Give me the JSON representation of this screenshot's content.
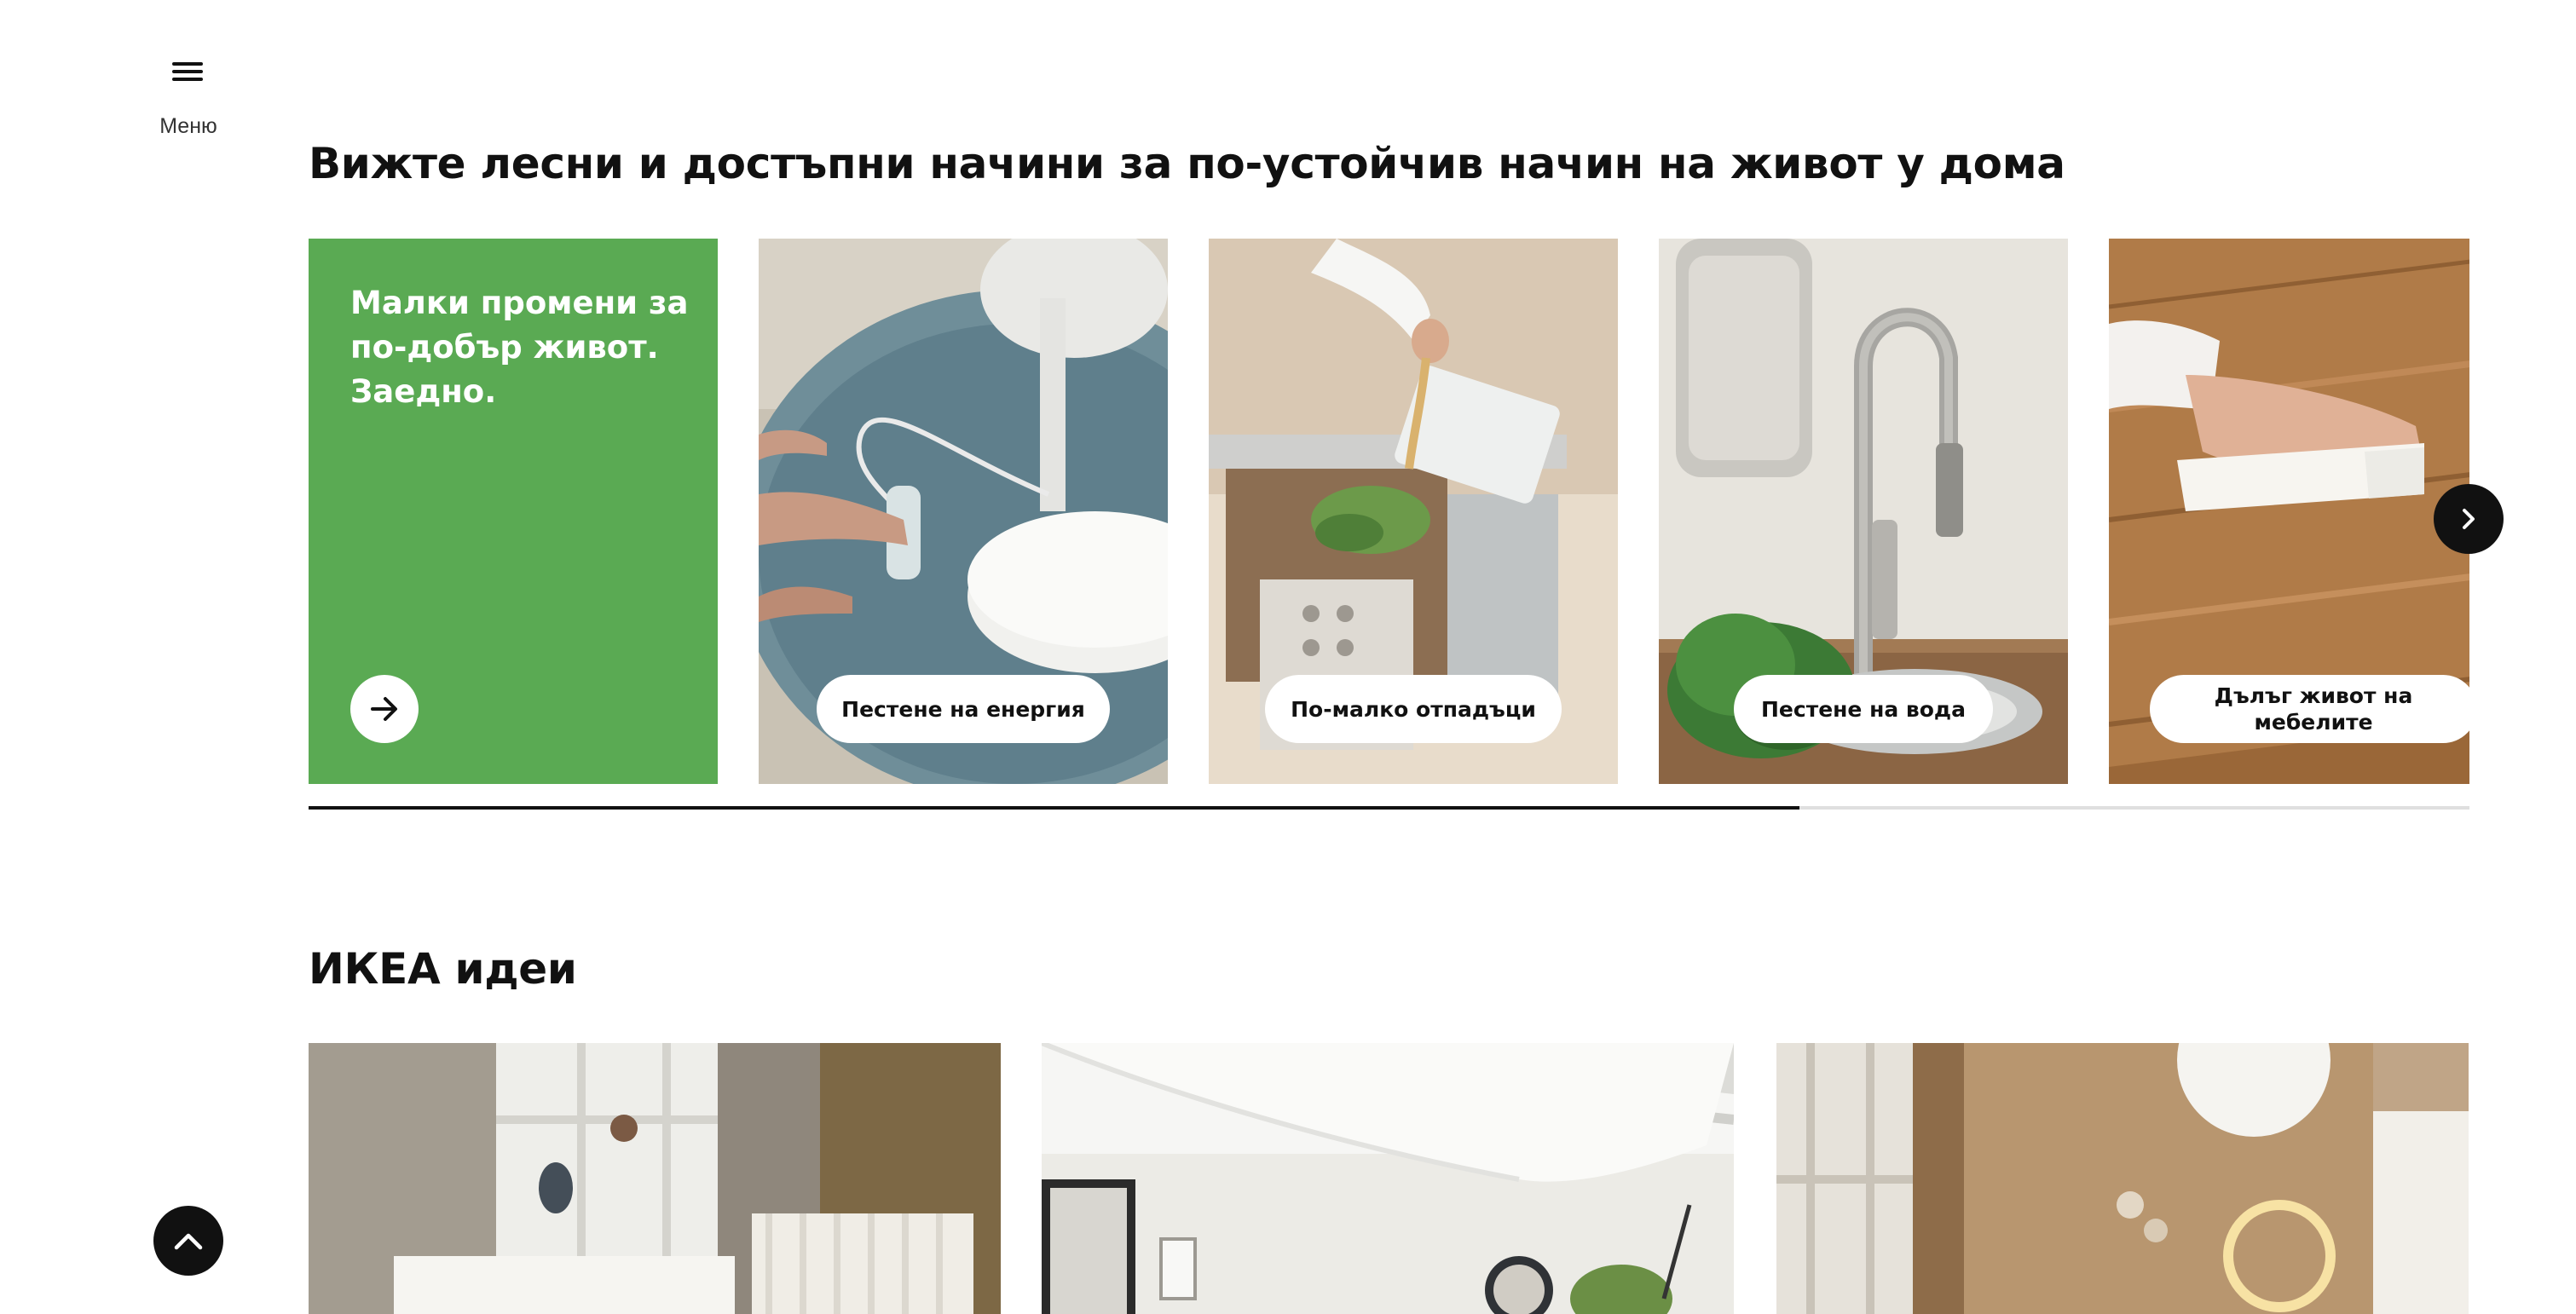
{
  "menu": {
    "label": "Меню",
    "icon": "hamburger-icon"
  },
  "sustainability": {
    "heading": "Вижте лесни и достъпни начини за по-устойчив начин на живот у дома",
    "intro_card": {
      "title": "Малки промени за по-добър живот. Заедно.",
      "color": "#5aaa53",
      "icon": "arrow-right-icon"
    },
    "cards": [
      {
        "label": "Пестене на енергия"
      },
      {
        "label": "По-малко отпадъци"
      },
      {
        "label": "Пестене на вода"
      },
      {
        "label": "Дълъг живот на мебелите"
      }
    ],
    "next_icon": "chevron-right-icon",
    "progress": 0.69
  },
  "ideas": {
    "heading": "ИКЕА идеи"
  },
  "back_to_top_icon": "chevron-up-icon"
}
